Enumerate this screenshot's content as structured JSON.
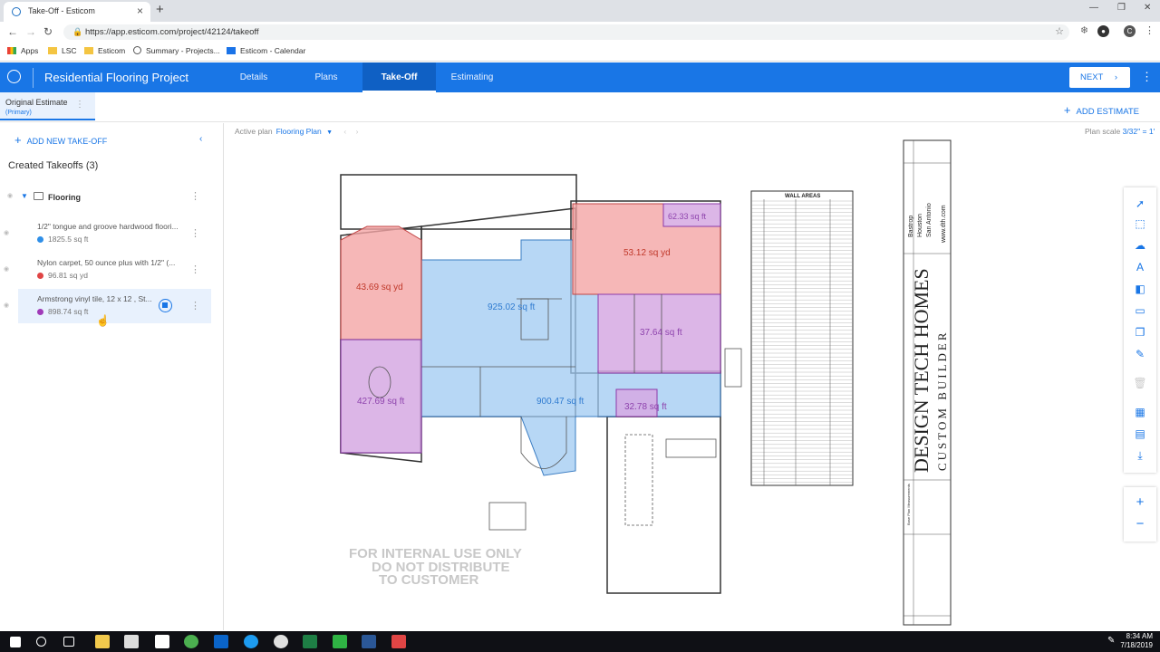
{
  "browser": {
    "tab_title": "Take-Off - Esticom",
    "url": "https://app.esticom.com/project/42124/takeoff",
    "bookmarks": [
      "Apps",
      "LSC",
      "Esticom",
      "Summary - Projects...",
      "Esticom - Calendar"
    ]
  },
  "app": {
    "project_title": "Residential Flooring Project",
    "nav_tabs": [
      "Details",
      "Plans",
      "Take-Off",
      "Estimating"
    ],
    "active_tab": "Take-Off",
    "next_label": "NEXT"
  },
  "estimate": {
    "name": "Original Estimate",
    "sub": "(Primary)",
    "add_label": "ADD ESTIMATE"
  },
  "sidebar": {
    "add_takeoff_label": "ADD NEW TAKE-OFF",
    "created_header": "Created Takeoffs (3)",
    "group_name": "Flooring",
    "takeoffs": [
      {
        "name": "1/2\" tongue and groove hardwood floori...",
        "qty": "1825.5 sq ft",
        "color": "#2f8fe8"
      },
      {
        "name": "Nylon carpet, 50 ounce plus with 1/2\" (...",
        "qty": "96.81 sq yd",
        "color": "#e04545"
      },
      {
        "name": "Armstrong vinyl tile, 12 x 12 , St...",
        "qty": "898.74 sq ft",
        "color": "#a03ab8"
      }
    ]
  },
  "main": {
    "active_plan_label": "Active plan",
    "active_plan_value": "Flooring Plan",
    "plan_scale_label": "Plan scale",
    "plan_scale_value": "3/32\" = 1'"
  },
  "plan": {
    "areas": [
      "43.69 sq yd",
      "925.02 sq ft",
      "53.12 sq yd",
      "62.33 sq ft",
      "37.64 sq ft",
      "427.69 sq ft",
      "900.47 sq ft",
      "32.78 sq ft"
    ],
    "watermark": [
      "FOR INTERNAL USE ONLY",
      "DO NOT DISTRIBUTE",
      "TO CUSTOMER"
    ],
    "wall_areas_title": "WALL AREAS",
    "title_block": {
      "company": "DESIGN TECH HOMES",
      "sub": "CUSTOM BUILDER",
      "cities": [
        "Bastrop",
        "Houston",
        "San Antonio"
      ],
      "website": "www.dth.com",
      "plan_name": "Base Plan Measurements"
    }
  },
  "taskbar": {
    "time": "8:34 AM",
    "date": "7/18/2019"
  }
}
